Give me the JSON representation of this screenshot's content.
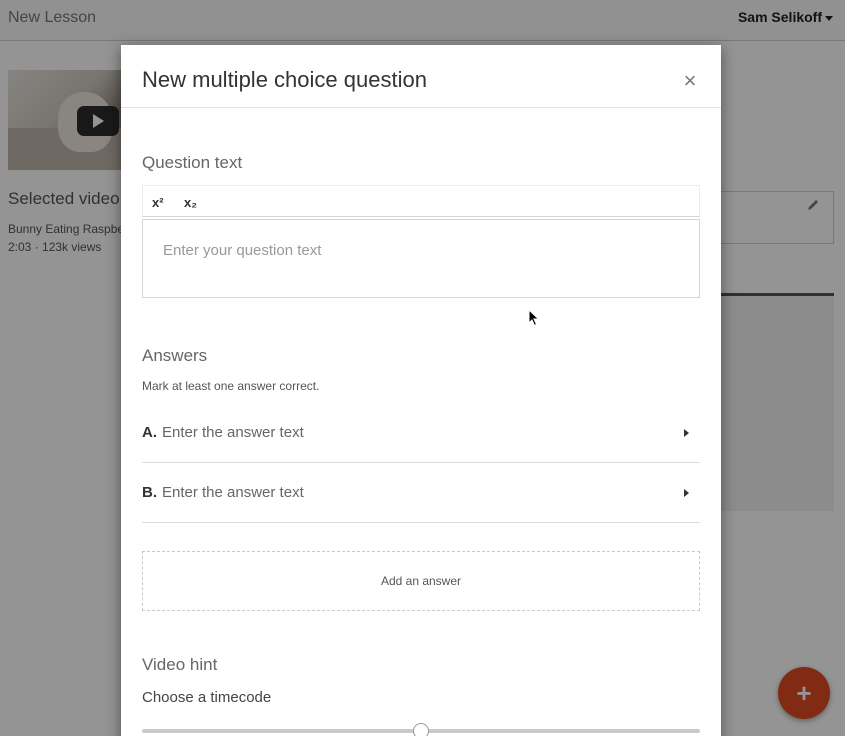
{
  "background": {
    "lesson_title": "New Lesson",
    "user_name": "Sam Selikoff",
    "selected_video_label": "Selected video",
    "video_title": "Bunny Eating Raspberries",
    "video_duration": "2:03",
    "video_views": "123k views",
    "video_meta": "2:03  ·  123k views",
    "fab_label": "+"
  },
  "modal": {
    "title": "New multiple choice question",
    "close_label": "×",
    "question_section_label": "Question text",
    "toolbar": {
      "superscript_label": "x²",
      "subscript_label": "x₂"
    },
    "question_placeholder": "Enter your question text",
    "answers_label": "Answers",
    "answers_hint": "Mark at least one answer correct.",
    "answers": [
      {
        "letter": "A.",
        "placeholder": "Enter the answer text"
      },
      {
        "letter": "B.",
        "placeholder": "Enter the answer text"
      }
    ],
    "add_answer_label": "Add an answer",
    "video_hint_label": "Video hint",
    "timecode_label": "Choose a timecode",
    "timecode_position_fraction": 0.5
  },
  "colors": {
    "fab": "#e04a23",
    "overlay": "rgba(0,0,0,0.42)"
  }
}
